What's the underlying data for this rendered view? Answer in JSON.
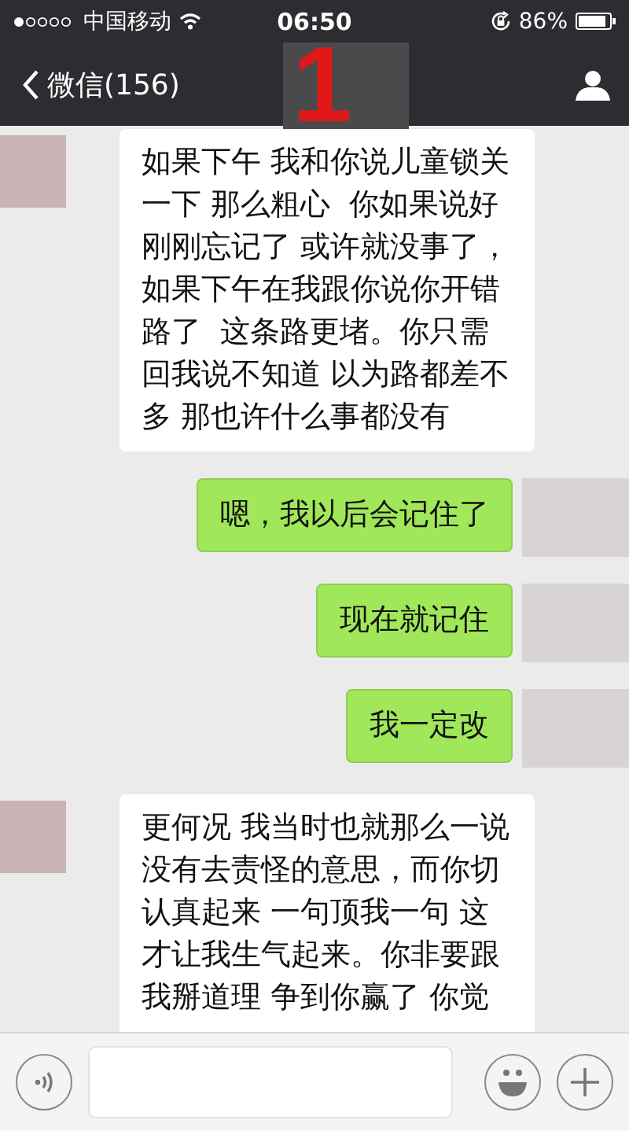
{
  "status_bar": {
    "carrier": "中国移动",
    "time": "06:50",
    "battery": "86%"
  },
  "nav_bar": {
    "back_label": "微信(156)"
  },
  "annotation": "1",
  "messages": [
    {
      "kind": "received",
      "text": "如果下午 我和你说儿童锁关一下 那么粗心  你如果说好刚刚忘记了 或许就没事了，如果下午在我跟你说你开错路了  这条路更堵。你只需回我说不知道 以为路都差不多 那也许什么事都没有"
    },
    {
      "kind": "sent",
      "text": "嗯，我以后会记住了"
    },
    {
      "kind": "sent",
      "text": "现在就记住"
    },
    {
      "kind": "sent",
      "text": "我一定改"
    },
    {
      "kind": "received",
      "text": "更何况 我当时也就那么一说没有去责怪的意思，而你切认真起来 一句顶我一句 这才让我生气起来。你非要跟我掰道理 争到你赢了 你觉"
    }
  ]
}
